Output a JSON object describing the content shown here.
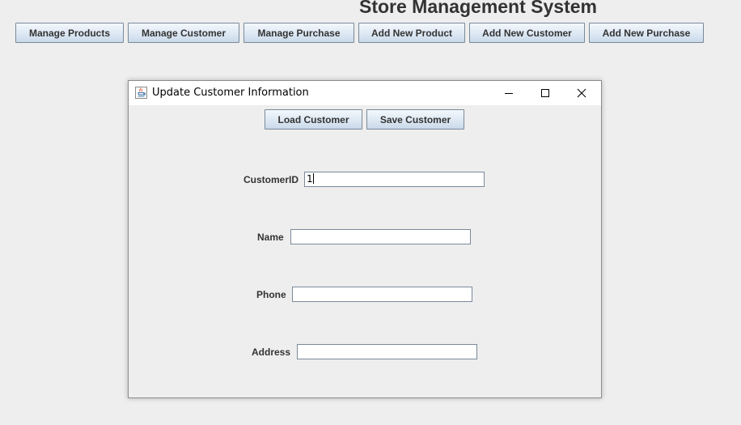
{
  "app": {
    "title": "Store Management System"
  },
  "toolbar": {
    "buttons": [
      {
        "label": "Manage Products"
      },
      {
        "label": "Manage Customer"
      },
      {
        "label": "Manage Purchase"
      },
      {
        "label": "Add New Product"
      },
      {
        "label": "Add New Customer"
      },
      {
        "label": "Add New Purchase"
      }
    ]
  },
  "dialog": {
    "title": "Update Customer Information",
    "icon": "java-cup-icon",
    "controls": [
      "minimize-icon",
      "maximize-icon",
      "close-icon"
    ],
    "actions": {
      "load_label": "Load Customer",
      "save_label": "Save Customer"
    },
    "fields": {
      "customer_id": {
        "label": "CustomerID",
        "value": "1"
      },
      "name": {
        "label": "Name",
        "value": ""
      },
      "phone": {
        "label": "Phone",
        "value": ""
      },
      "address": {
        "label": "Address",
        "value": ""
      }
    }
  },
  "colors": {
    "background": "#eeeeee",
    "button_gradient_top": "#f3f8fd",
    "button_gradient_bottom": "#c9d9ea",
    "button_border": "#7a8a99",
    "text": "#333333"
  }
}
